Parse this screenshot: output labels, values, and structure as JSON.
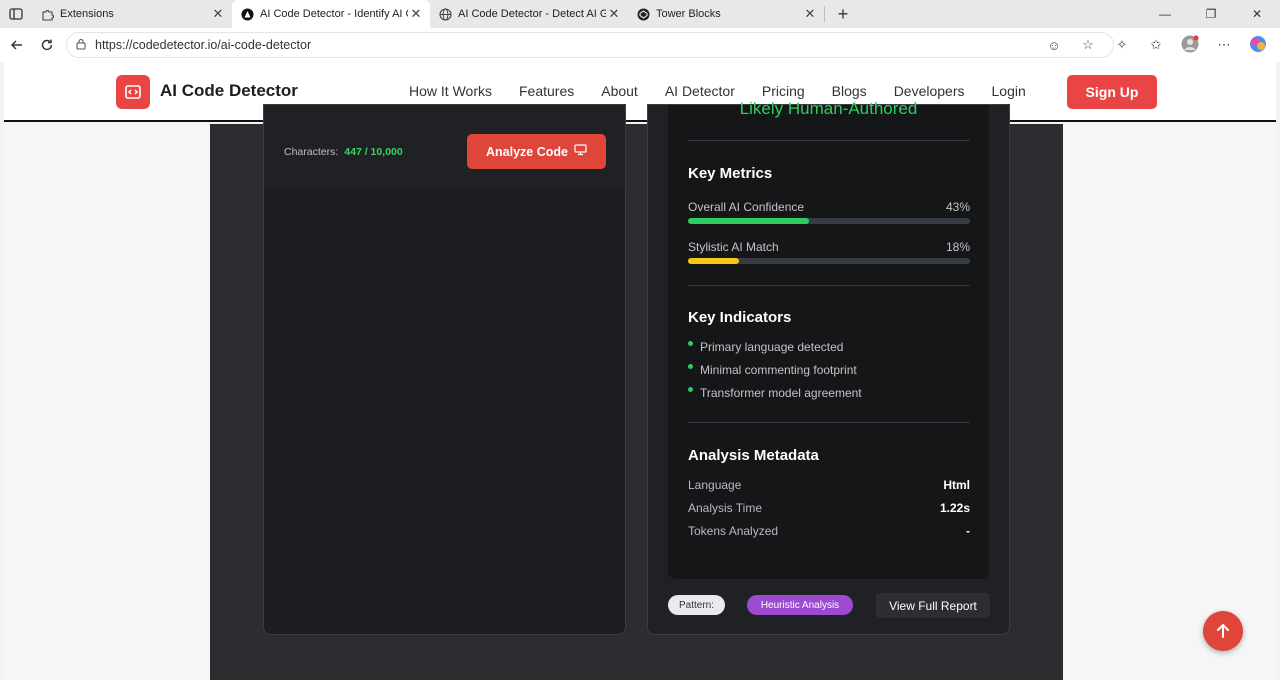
{
  "browser": {
    "tabs": [
      {
        "label": "Extensions",
        "active": false
      },
      {
        "label": "AI Code Detector - Identify AI Ge",
        "active": true
      },
      {
        "label": "AI Code Detector - Detect AI Gen",
        "active": false
      },
      {
        "label": "Tower Blocks",
        "active": false
      }
    ],
    "url": "https://codedetector.io/ai-code-detector"
  },
  "header": {
    "logo": "AI Code Detector",
    "nav": [
      "How It Works",
      "Features",
      "About",
      "AI Detector",
      "Pricing",
      "Blogs",
      "Developers",
      "Login"
    ],
    "signup": "Sign Up"
  },
  "input_panel": {
    "characters_label": "Characters:",
    "characters_value": "447 / 10,000",
    "analyze_button": "Analyze Code"
  },
  "results": {
    "verdict": "Likely Human-Authored",
    "key_metrics_title": "Key Metrics",
    "metrics": [
      {
        "label": "Overall AI Confidence",
        "value": "43%",
        "fraction": 0.43,
        "color": "#2ecc60"
      },
      {
        "label": "Stylistic AI Match",
        "value": "18%",
        "fraction": 0.18,
        "color": "#f5c518"
      }
    ],
    "key_indicators_title": "Key Indicators",
    "indicators": [
      "Primary language detected",
      "Minimal commenting footprint",
      "Transformer model agreement"
    ],
    "metadata_title": "Analysis Metadata",
    "metadata": [
      {
        "key": "Language",
        "value": "Html"
      },
      {
        "key": "Analysis Time",
        "value": "1.22s"
      },
      {
        "key": "Tokens Analyzed",
        "value": "-"
      }
    ],
    "pattern_label": "Pattern:",
    "pattern_tag": "Heuristic Analysis",
    "view_report": "View Full Report"
  }
}
